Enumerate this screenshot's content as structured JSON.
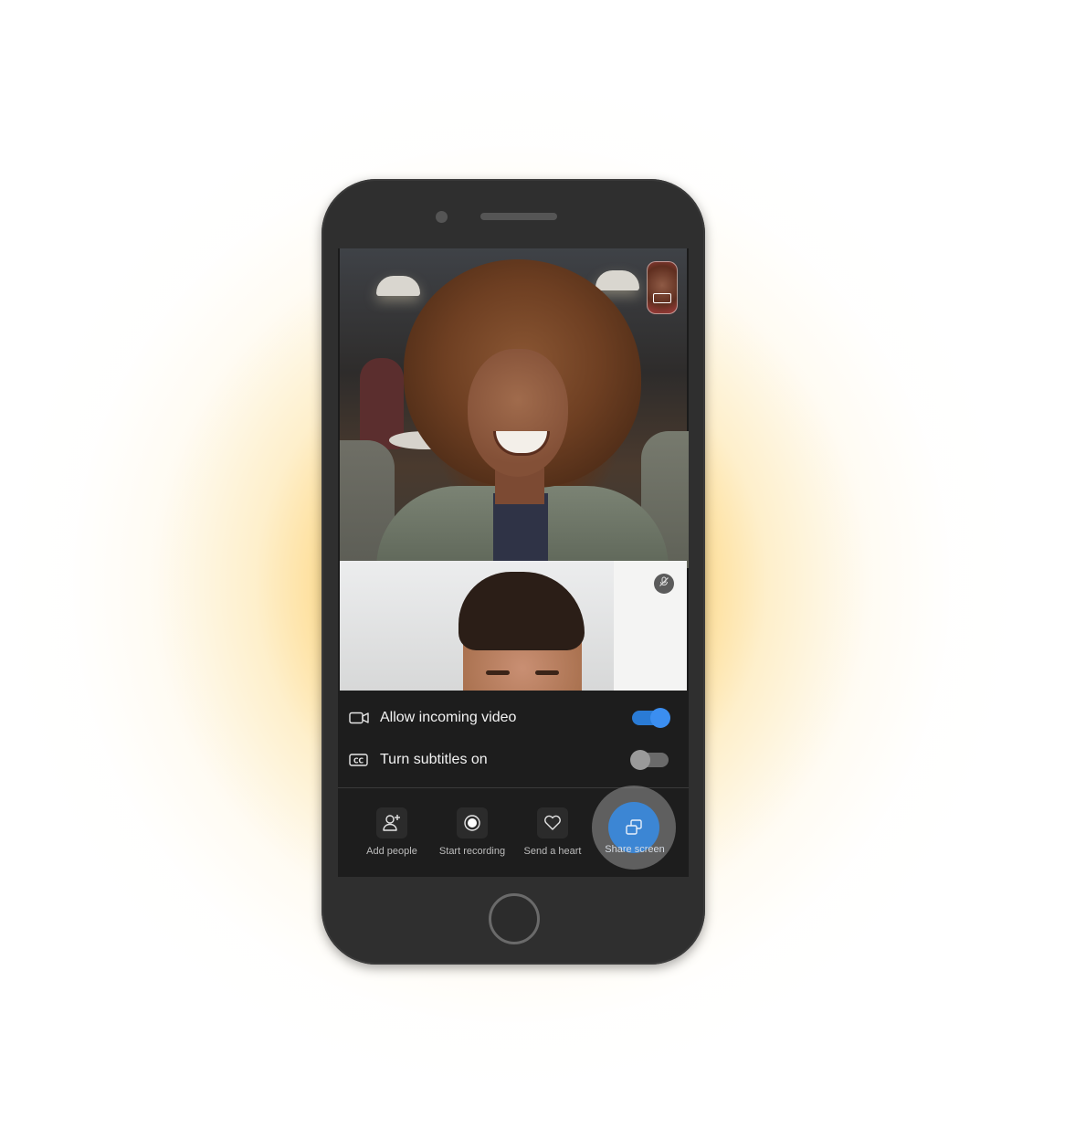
{
  "settings": {
    "incoming_video": {
      "label": "Allow incoming video",
      "enabled": true
    },
    "subtitles": {
      "label": "Turn subtitles on",
      "enabled": false
    }
  },
  "actions": {
    "add_people": "Add people",
    "start_recording": "Start recording",
    "send_heart": "Send a heart",
    "share_screen": "Share screen"
  },
  "icons": {
    "incoming_video": "video-camera-icon",
    "subtitles": "closed-captions-icon",
    "add_people": "add-person-icon",
    "start_recording": "record-icon",
    "send_heart": "heart-icon",
    "share_screen": "share-screen-icon",
    "mute": "microphone-muted-icon"
  },
  "colors": {
    "accent": "#3b8ef0",
    "glow": "#fcb628",
    "phone_body": "#2f2f2f",
    "panel_bg": "#1d1d1d"
  }
}
